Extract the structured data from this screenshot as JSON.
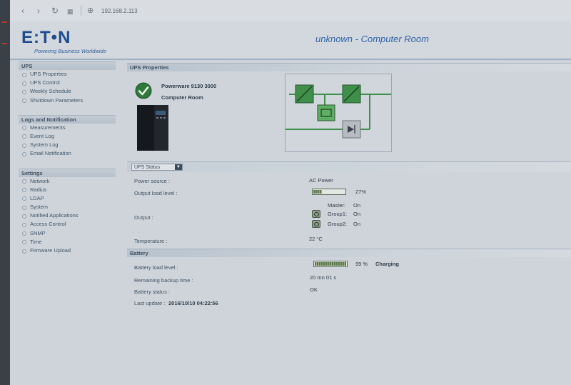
{
  "browser": {
    "url": "192.168.2.113",
    "icons": [
      "back-icon",
      "forward-icon",
      "reload-icon",
      "apps-grid-icon",
      "globe-icon"
    ]
  },
  "header": {
    "logo_text": "E:T•N",
    "tagline": "Powering Business Worldwide",
    "device_title": "unknown  -  Computer Room"
  },
  "sidebar": {
    "groups": [
      {
        "title": "UPS",
        "items": [
          "UPS Properties",
          "UPS Control",
          "Weekly Schedule",
          "Shutdown Parameters"
        ]
      },
      {
        "title": "Logs and Notification",
        "items": [
          "Measurements",
          "Event Log",
          "System Log",
          "Email Notification"
        ]
      },
      {
        "title": "Settings",
        "items": [
          "Network",
          "Radius",
          "LDAP",
          "System",
          "Notified Applications",
          "Access Control",
          "SNMP",
          "Time",
          "Firmware Upload"
        ]
      }
    ]
  },
  "main": {
    "section_title": "UPS Properties",
    "model": "Powerware 9130 3000",
    "location": "Computer Room",
    "status_select": "UPS Status",
    "status": {
      "power_source_label": "Power source :",
      "power_source_value": "AC Power",
      "output_load_label": "Output load level :",
      "output_load_value": "27%",
      "output_load_fraction": 0.27,
      "output_label": "Output :",
      "master_label": "Master:",
      "master_value": "On",
      "group1_label": "Group1:",
      "group1_value": "On",
      "group2_label": "Group2:",
      "group2_value": "On",
      "temperature_label": "Temperature :",
      "temperature_value": "22 °C"
    },
    "battery_title": "Battery",
    "battery": {
      "load_label": "Battery load level :",
      "load_value": "99 %",
      "load_fraction": 0.99,
      "charging": "Charging",
      "backup_label": "Remaining backup time :",
      "backup_value": "20 mn 01 s",
      "status_label": "Battery status :",
      "status_value": "OK",
      "last_update_label": "Last update :",
      "last_update_value": "2016/10/10 04:22:56"
    }
  },
  "colors": {
    "brand_blue": "#1d4d8f",
    "ok_green": "#2f7a3a",
    "diagram_green": "#3f8f4a"
  }
}
